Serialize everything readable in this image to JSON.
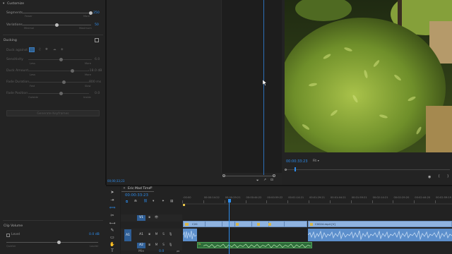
{
  "left_panel": {
    "customize_title": "Customize",
    "segments_label": "Segments",
    "segments_value": "250",
    "segments_min": "Fewer",
    "segments_max": "More",
    "variations_label": "Variations",
    "variations_value": "50",
    "variations_min": "Minimal",
    "variations_max": "Maximum",
    "ducking_title": "Ducking",
    "duck_against_label": "Duck against",
    "sensitivity_label": "Sensitivity",
    "sensitivity_value": "6.0",
    "duck_amount_label": "Duck Amount",
    "duck_amount_value": "-18.0 dB",
    "fade_duration_label": "Fade Duration",
    "fade_duration_value": "800 ms",
    "fade_position_label": "Fade Position",
    "fade_position_value": "0.0",
    "less_label": "Less",
    "more_label": "More",
    "fast_label": "Fast",
    "slow_label": "Slow",
    "outside_label": "Outside",
    "inside_label": "Inside",
    "generate_button": "Generate Keyframes",
    "clip_volume_title": "Clip Volume",
    "level_label": "Level",
    "level_value": "0.0 dB",
    "level_min": "Quieter",
    "level_max": "Louder"
  },
  "source_monitor": {
    "timecode": "00;00;33;23"
  },
  "program_monitor": {
    "timecode": "00:00:33:23",
    "fit_label": "Fit",
    "scrub_position": 0.05
  },
  "timeline": {
    "sequence_name": "Eric Mad Time",
    "timecode": "00:00:33:23",
    "ruler_labels": [
      ":00:00",
      "00:00:14:22",
      "00:00:29:21",
      "00:00:44:22",
      "00:00:59:22",
      "00:01:14:21",
      "00:01:29:21",
      "00:01:44:21",
      "00:01:59:21",
      "00:02:14:21",
      "00:02:29:20",
      "00:02:44:20",
      "00:02:59:19"
    ],
    "playhead_fraction": 0.174,
    "tracks": [
      "V1",
      "A1",
      "A2"
    ],
    "track_controls": {
      "mute": "M",
      "solo": "S",
      "lock": "🔒"
    },
    "clips": {
      "v1_left": "C20",
      "v1_right": "C0024.mp4 [V]",
      "a2_label": "fx"
    },
    "mix_label": "Mix",
    "mix_value": "0.0"
  },
  "colors": {
    "accent": "#2d8ceb",
    "video_clip": "#8fb3e0",
    "audio_clip": "#5c8fcc",
    "music_clip": "#2e6d3a",
    "marker": "#e6c34a"
  }
}
